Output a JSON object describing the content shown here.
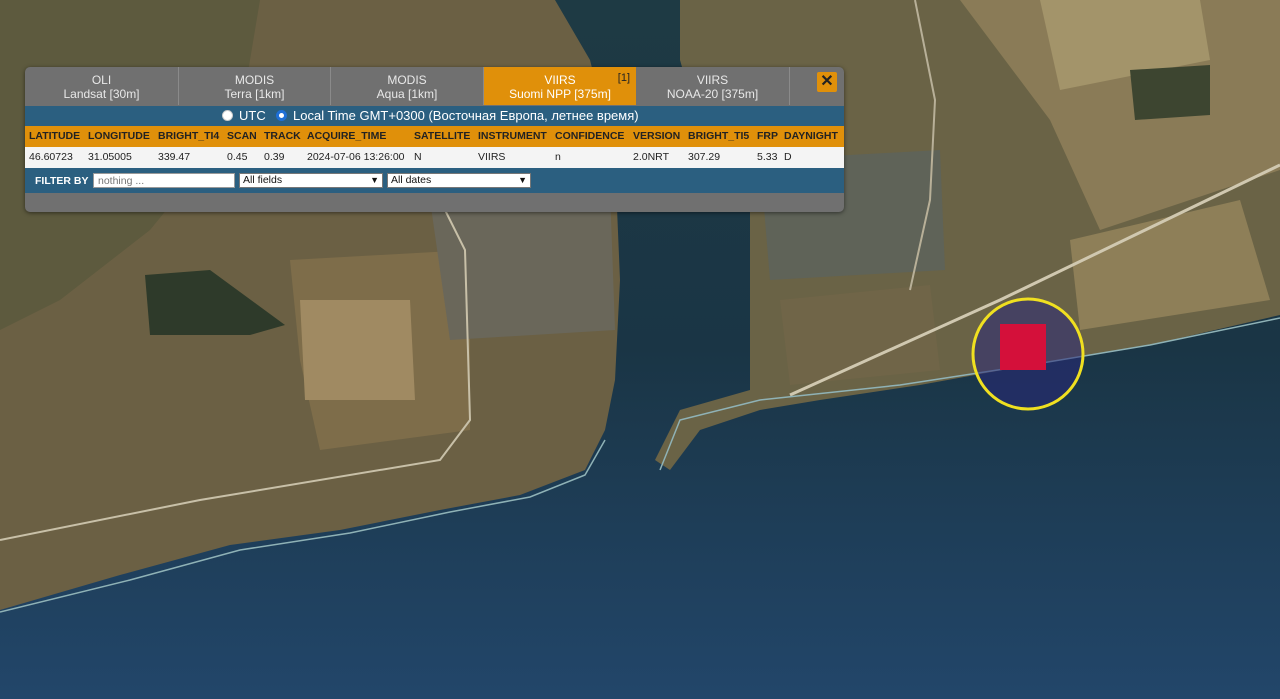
{
  "tabs": [
    {
      "line1": "OLI",
      "line2": "Landsat [30m]",
      "active": false
    },
    {
      "line1": "MODIS",
      "line2": "Terra [1km]",
      "active": false
    },
    {
      "line1": "MODIS",
      "line2": "Aqua [1km]",
      "active": false
    },
    {
      "line1": "VIIRS",
      "line2": "Suomi NPP [375m]",
      "active": true,
      "count": "[1]"
    },
    {
      "line1": "VIIRS",
      "line2": "NOAA-20 [375m]",
      "active": false
    }
  ],
  "close_label": "✕",
  "time": {
    "utc_label": "UTC",
    "local_label": "Local Time GMT+0300 (Восточная Европа, летнее время)",
    "selected": "local"
  },
  "table": {
    "headers": [
      "LATITUDE",
      "LONGITUDE",
      "BRIGHT_TI4",
      "SCAN",
      "TRACK",
      "ACQUIRE_TIME",
      "SATELLITE",
      "INSTRUMENT",
      "CONFIDENCE",
      "VERSION",
      "BRIGHT_TI5",
      "FRP",
      "DAYNIGHT"
    ],
    "rows": [
      [
        "46.60723",
        "31.05005",
        "339.47",
        "0.45",
        "0.39",
        "2024-07-06 13:26:00",
        "N",
        "VIIRS",
        "n",
        "2.0NRT",
        "307.29",
        "5.33",
        "D"
      ]
    ]
  },
  "filter": {
    "label": "FILTER BY",
    "placeholder": "nothing ...",
    "field_select": "All fields",
    "date_select": "All dates"
  },
  "colors": {
    "accent": "#e0900a",
    "header_blue": "#2b5f80",
    "hotspot": "#d4103a",
    "highlight_ring": "#f0e020"
  }
}
